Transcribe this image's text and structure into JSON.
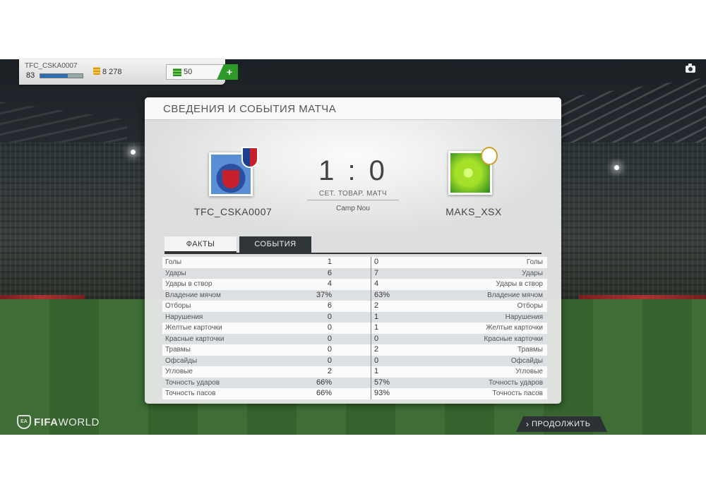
{
  "account": {
    "name": "TFC_CSKA0007",
    "level": "83",
    "level_progress": 0.65,
    "coins": "8 278",
    "points": "50",
    "add_label": "+"
  },
  "panel": {
    "title": "СВЕДЕНИЯ И СОБЫТИЯ МАТЧА"
  },
  "match": {
    "home_team": "TFC_CSKA0007",
    "away_team": "MAKS_XSX",
    "score": "1 : 0",
    "type": "СЕТ. ТОВАР. МАТЧ",
    "venue": "Camp Nou"
  },
  "tabs": {
    "facts": "ФАКТЫ",
    "events": "СОБЫТИЯ"
  },
  "stats": [
    {
      "label": "Голы",
      "home": "1",
      "away": "0"
    },
    {
      "label": "Удары",
      "home": "6",
      "away": "7"
    },
    {
      "label": "Удары в створ",
      "home": "4",
      "away": "4"
    },
    {
      "label": "Владение мячом",
      "home": "37%",
      "away": "63%"
    },
    {
      "label": "Отборы",
      "home": "6",
      "away": "2"
    },
    {
      "label": "Нарушения",
      "home": "0",
      "away": "1"
    },
    {
      "label": "Желтые карточки",
      "home": "0",
      "away": "1"
    },
    {
      "label": "Красные карточки",
      "home": "0",
      "away": "0"
    },
    {
      "label": "Травмы",
      "home": "0",
      "away": "2"
    },
    {
      "label": "Офсайды",
      "home": "0",
      "away": "0"
    },
    {
      "label": "Угловые",
      "home": "2",
      "away": "1"
    },
    {
      "label": "Точность ударов",
      "home": "66%",
      "away": "57%"
    },
    {
      "label": "Точность пасов",
      "home": "66%",
      "away": "93%"
    }
  ],
  "footer": {
    "logo_bold": "FIFA",
    "logo_thin": "WORLD",
    "logo_ea": "EA",
    "continue_label": "ПРОДОЛЖИТЬ",
    "continue_chevron": "›"
  }
}
